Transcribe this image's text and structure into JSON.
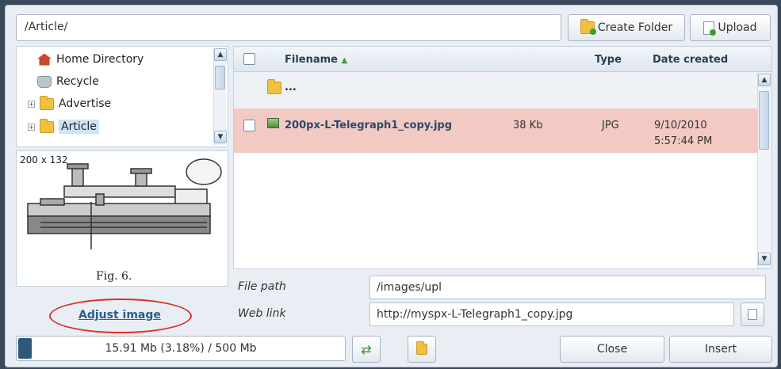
{
  "toolbar": {
    "path": "/Article/",
    "create_folder": "Create Folder",
    "upload": "Upload"
  },
  "tree": {
    "items": [
      {
        "label": "Home Directory",
        "icon": "home-icon"
      },
      {
        "label": "Recycle",
        "icon": "recycle-bin-icon"
      },
      {
        "label": "Advertise",
        "icon": "folder-icon"
      },
      {
        "label": "Article",
        "icon": "folder-open-icon"
      }
    ]
  },
  "preview": {
    "dimensions": "200 x 132",
    "caption": "Fig. 6.",
    "adjust_link": "Adjust image"
  },
  "list": {
    "headers": {
      "filename": "Filename",
      "type": "Type",
      "date": "Date created"
    },
    "up_label": "...",
    "files": [
      {
        "name": "200px-L-Telegraph1_copy.jpg",
        "size": "38 Kb",
        "type": "JPG",
        "date": "9/10/2010",
        "time": "5:57:44 PM"
      }
    ]
  },
  "fields": {
    "file_path_label": "File path",
    "file_path_value": "/images/upl",
    "web_link_label": "Web link",
    "web_link_value": "http://myspx-L-Telegraph1_copy.jpg"
  },
  "footer": {
    "quota": "15.91 Mb (3.18%) / 500 Mb",
    "quota_fraction": 0.0318,
    "close": "Close",
    "insert": "Insert"
  },
  "colors": {
    "selected_row": "#f3c9c4",
    "header_bg": "#dde6ef",
    "link": "#2b5f8a",
    "highlight_oval": "#d8322a"
  }
}
